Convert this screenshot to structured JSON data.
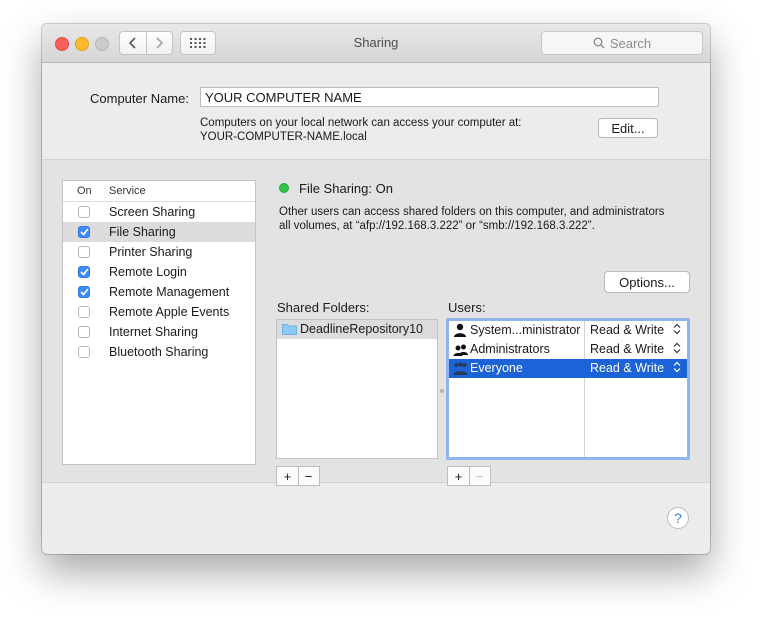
{
  "window": {
    "title": "Sharing",
    "search": {
      "placeholder": "Search",
      "icon": "search-icon"
    }
  },
  "computer_name": {
    "label": "Computer Name:",
    "value": "YOUR COMPUTER NAME",
    "note_line1": "Computers on your local network can access your computer at:",
    "note_line2": "YOUR-COMPUTER-NAME.local",
    "edit_button": "Edit..."
  },
  "services": {
    "header_on": "On",
    "header_service": "Service",
    "items": [
      {
        "label": "Screen Sharing",
        "checked": false,
        "selected": false
      },
      {
        "label": "File Sharing",
        "checked": true,
        "selected": true
      },
      {
        "label": "Printer Sharing",
        "checked": false,
        "selected": false
      },
      {
        "label": "Remote Login",
        "checked": true,
        "selected": false
      },
      {
        "label": "Remote Management",
        "checked": true,
        "selected": false
      },
      {
        "label": "Remote Apple Events",
        "checked": false,
        "selected": false
      },
      {
        "label": "Internet Sharing",
        "checked": false,
        "selected": false
      },
      {
        "label": "Bluetooth Sharing",
        "checked": false,
        "selected": false
      }
    ]
  },
  "detail": {
    "status": "File Sharing: On",
    "status_color": "#2fc447",
    "description_line1": "Other users can access shared folders on this computer, and administrators",
    "description_line2": "all volumes, at “afp://192.168.3.222” or “smb://192.168.3.222”.",
    "options_button": "Options...",
    "shared_folders_label": "Shared Folders:",
    "users_label": "Users:",
    "shared_folders": [
      {
        "name": "DeadlineRepository10",
        "icon": "folder-icon"
      }
    ],
    "users": [
      {
        "name": "System...ministrator",
        "permission": "Read & Write",
        "icon": "user-icon",
        "selected": false
      },
      {
        "name": "Administrators",
        "permission": "Read & Write",
        "icon": "group-icon",
        "selected": false
      },
      {
        "name": "Everyone",
        "permission": "Read & Write",
        "icon": "everyone-icon",
        "selected": true
      }
    ],
    "add_symbol": "+",
    "remove_symbol": "−"
  },
  "help_button": "?",
  "colors": {
    "accent": "#3c8af7",
    "selection": "#1c63d8"
  }
}
